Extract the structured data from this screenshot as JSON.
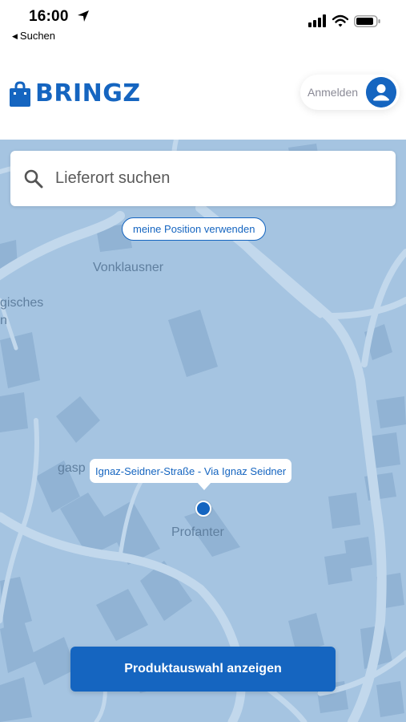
{
  "status_bar": {
    "time": "16:00",
    "back_label": "Suchen",
    "icons": [
      "location-arrow-icon",
      "cellular-signal-icon",
      "wifi-icon",
      "battery-icon"
    ]
  },
  "header": {
    "logo_text": "BRINGZ",
    "logo_icon": "shopping-bag-icon",
    "login_label": "Anmelden",
    "avatar_icon": "user-icon"
  },
  "search": {
    "placeholder": "Lieferort suchen",
    "icon": "search-icon"
  },
  "position_button_label": "meine Position verwenden",
  "map": {
    "labels": {
      "vonklausner": "Vonklausner",
      "gisches": "gisches",
      "n": "n",
      "gasp": "gasp",
      "profanter": "Profanter"
    },
    "selected_address": "Ignaz-Seidner-Straße - Via Ignaz Seidner"
  },
  "cta_label": "Produktauswahl anzeigen",
  "colors": {
    "brand": "#1565c0",
    "map_background": "#a5c4e1",
    "map_roads": "#c2d8ec",
    "map_buildings": "#8fb0d1"
  }
}
